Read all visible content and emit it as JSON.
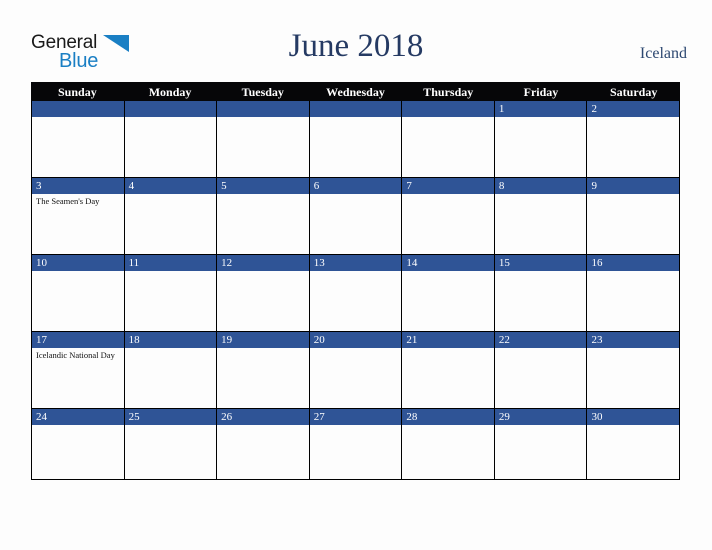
{
  "brand": {
    "name_part1": "General",
    "name_part2": "Blue",
    "triangle_color": "#1a7fc4"
  },
  "header": {
    "title": "June 2018",
    "country": "Iceland"
  },
  "calendar": {
    "weekday_headers": [
      "Sunday",
      "Monday",
      "Tuesday",
      "Wednesday",
      "Thursday",
      "Friday",
      "Saturday"
    ],
    "accent_color": "#2f5496",
    "header_bar_color": "#060608",
    "weeks": [
      [
        {
          "num": "",
          "events": []
        },
        {
          "num": "",
          "events": []
        },
        {
          "num": "",
          "events": []
        },
        {
          "num": "",
          "events": []
        },
        {
          "num": "",
          "events": []
        },
        {
          "num": "1",
          "events": []
        },
        {
          "num": "2",
          "events": []
        }
      ],
      [
        {
          "num": "3",
          "events": [
            "The Seamen's Day"
          ]
        },
        {
          "num": "4",
          "events": []
        },
        {
          "num": "5",
          "events": []
        },
        {
          "num": "6",
          "events": []
        },
        {
          "num": "7",
          "events": []
        },
        {
          "num": "8",
          "events": []
        },
        {
          "num": "9",
          "events": []
        }
      ],
      [
        {
          "num": "10",
          "events": []
        },
        {
          "num": "11",
          "events": []
        },
        {
          "num": "12",
          "events": []
        },
        {
          "num": "13",
          "events": []
        },
        {
          "num": "14",
          "events": []
        },
        {
          "num": "15",
          "events": []
        },
        {
          "num": "16",
          "events": []
        }
      ],
      [
        {
          "num": "17",
          "events": [
            "Icelandic National Day"
          ]
        },
        {
          "num": "18",
          "events": []
        },
        {
          "num": "19",
          "events": []
        },
        {
          "num": "20",
          "events": []
        },
        {
          "num": "21",
          "events": []
        },
        {
          "num": "22",
          "events": []
        },
        {
          "num": "23",
          "events": []
        }
      ],
      [
        {
          "num": "24",
          "events": []
        },
        {
          "num": "25",
          "events": []
        },
        {
          "num": "26",
          "events": []
        },
        {
          "num": "27",
          "events": []
        },
        {
          "num": "28",
          "events": []
        },
        {
          "num": "29",
          "events": []
        },
        {
          "num": "30",
          "events": []
        }
      ]
    ]
  }
}
